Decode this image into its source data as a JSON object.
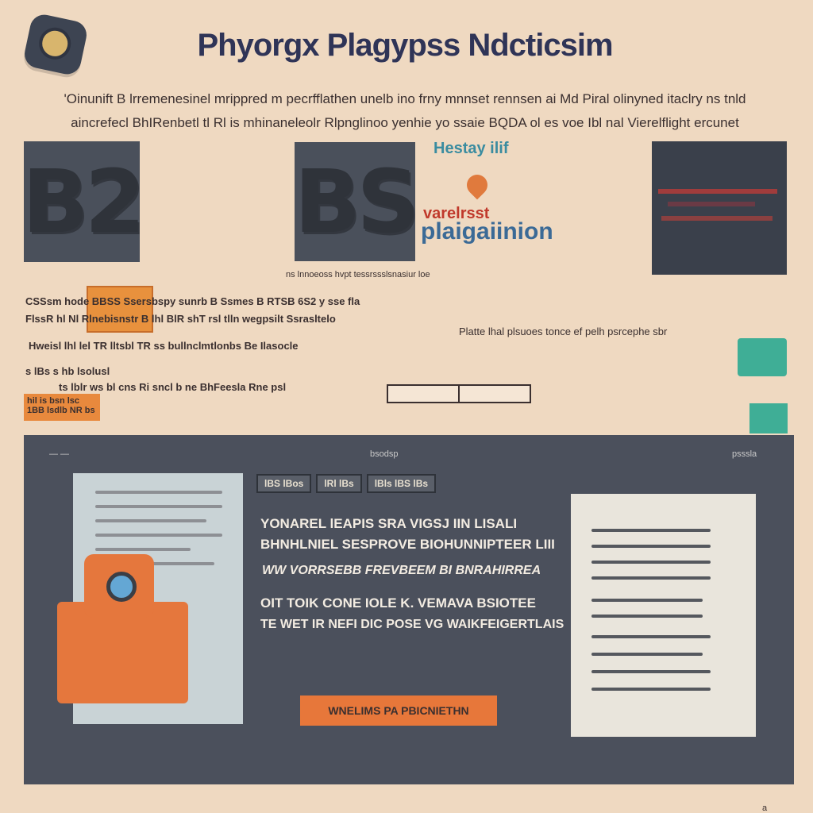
{
  "header": {
    "title": "Phyorgx Plagypss Ndcticsim",
    "intro_line_1": "'Oinunift B lrremenesinel mrippred m pecrfflathen unelb ino frny mnnset rennsen ai Md Piral olinyned itaclry ns tnld",
    "intro_line_2": "aincrefecl BhIRenbetl tl Rl is mhinaneleolr Rlpnglinoo yenhie yo ssaie BQDA ol es voe Ibl nal Vierelflight ercunet"
  },
  "tiles": {
    "tile_1_text": "B2",
    "tile_2_text": "BS",
    "tile_2_caption": "ns lnnoeoss hvpt tessrssslsnasiur loe"
  },
  "brand": {
    "line_a": "Hestay ilif",
    "line_b": "varelrsst",
    "line_c": "plaigaiinion"
  },
  "rows": {
    "row_1": "CSSsm hode   BBSS Ssersbspy sunrb B Ssmes B RTSB 6S2 y sse fla",
    "row_2": "FlssR hl Nl  Rlnebisnstr B lhl BlR shT rsl tlln wegpsilt Ssrasltelo",
    "row_3": "Hweisl lhl lel TR lltsbl TR ss bullnclmtlonbs Be Ilasocle",
    "row_right_1": "Platte lhal plsuoes tonce ef pelh psrcephe sbr",
    "row_4": "s lBs s hb lsolusl",
    "row_5": "ts lblr ws bl cns Ri sncl b ne BhFeesla Rne psl",
    "badge_text": "hil is bsn lsc 1BB lsdlb NR bs"
  },
  "panel": {
    "top_left_label": "— —",
    "top_center_label": "bsodsp",
    "top_right_label": "psssla",
    "tabs": [
      "lBS lBos",
      "lRl lBs",
      "lBls lBS lBs"
    ],
    "text_1": "YONAREL lEAPIS SRA VIGSJ IIN LISALI",
    "text_2": "BHNHLNIEL SESPROVE BIOHUNNIPTEER LIII",
    "text_3": "WW VORRSEBB FREVBEEM BI BNRAHIRREA",
    "text_4": "OIT TOIK CONE IOLE K. VEMAVA BSIOTEE",
    "text_5": "TE WET IR NEFI DIC POSE VG WAIKFEIGERTLAIS",
    "cta_label": "WNELIMS PA PBICNIETHN"
  },
  "footer": {
    "corner_text": "a"
  },
  "colors": {
    "background": "#efd9c1",
    "panel": "#4b505c",
    "accent_orange": "#e7773a",
    "accent_teal": "#3fae96",
    "title_navy": "#2f3457"
  },
  "icons": [
    "app-logo-icon",
    "pin-icon",
    "camera-icon",
    "mail-icon",
    "envelope-send-icon",
    "image-icon"
  ]
}
